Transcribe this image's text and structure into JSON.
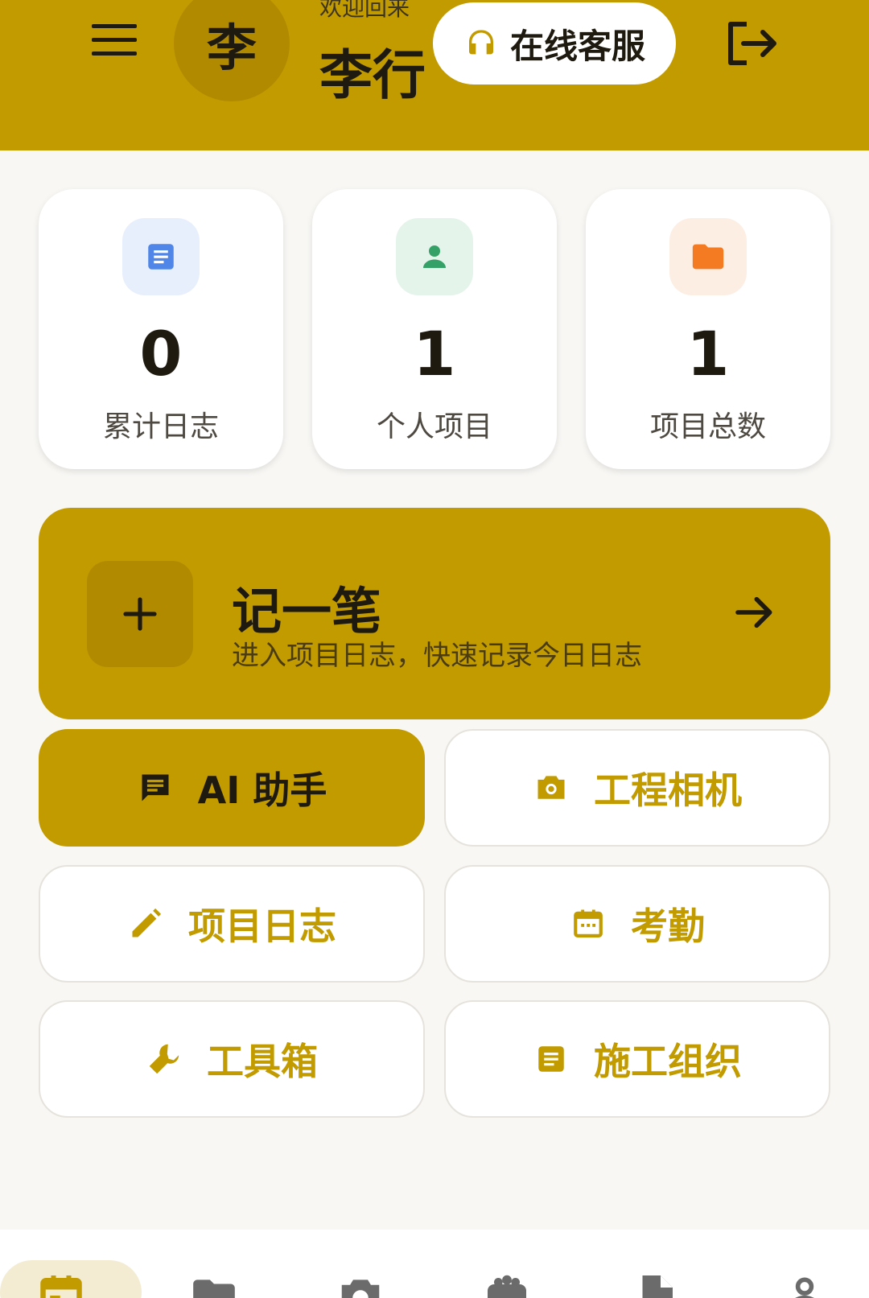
{
  "header": {
    "welcome": "欢迎回来",
    "username": "李行",
    "avatar_initial": "李",
    "service_label": "在线客服"
  },
  "stats": [
    {
      "value": "0",
      "label": "累计日志",
      "icon": "document-icon",
      "icon_bg": "#e8effc",
      "icon_color": "#4f86e8"
    },
    {
      "value": "1",
      "label": "个人项目",
      "icon": "person-icon",
      "icon_bg": "#e4f4ea",
      "icon_color": "#34a266"
    },
    {
      "value": "1",
      "label": "项目总数",
      "icon": "folder-icon",
      "icon_bg": "#fdeee4",
      "icon_color": "#f47b22"
    }
  ],
  "banner": {
    "title": "记一笔",
    "subtitle": "进入项目日志，快速记录今日日志"
  },
  "actions": {
    "ai_assistant": "AI 助手",
    "engineering_camera": "工程相机",
    "project_log": "项目日志",
    "attendance": "考勤",
    "toolbox": "工具箱",
    "construction_org": "施工组织"
  },
  "colors": {
    "accent": "#c29b00",
    "accent_dark": "#b28a00",
    "background": "#f8f7f4"
  },
  "bottom_nav": [
    {
      "icon": "calendar-icon",
      "active": true
    },
    {
      "icon": "folder-icon",
      "active": false
    },
    {
      "icon": "camera-icon",
      "active": false
    },
    {
      "icon": "robot-icon",
      "active": false
    },
    {
      "icon": "file-icon",
      "active": false
    },
    {
      "icon": "person-icon",
      "active": false
    }
  ]
}
